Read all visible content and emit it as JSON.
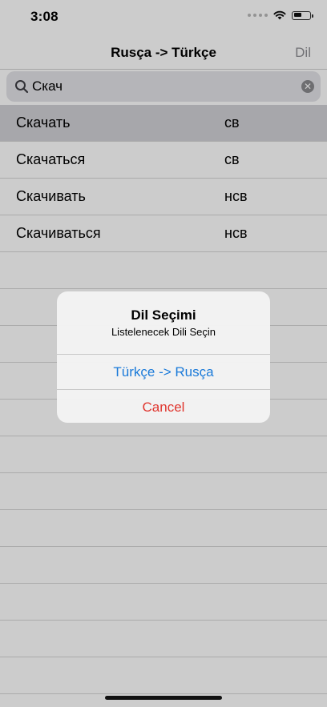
{
  "status_bar": {
    "time": "3:08",
    "battery_level": 0.55
  },
  "nav": {
    "title": "Rusça -> Türkçe",
    "action_label": "Dil"
  },
  "search": {
    "value": "Скач",
    "placeholder": ""
  },
  "rows": [
    {
      "word": "Скачать",
      "aspect": "св",
      "selected": true
    },
    {
      "word": "Скачаться",
      "aspect": "св",
      "selected": false
    },
    {
      "word": "Скачивать",
      "aspect": "нсв",
      "selected": false
    },
    {
      "word": "Скачиваться",
      "aspect": "нсв",
      "selected": false
    }
  ],
  "alert": {
    "title": "Dil Seçimi",
    "message": "Listelenecek Dili Seçin",
    "buttons": {
      "primary": "Türkçe -> Rusça",
      "cancel": "Cancel"
    }
  },
  "colors": {
    "primary_button": "#1a7ad9",
    "cancel_button": "#e0362f",
    "selected_row": "#d1d1d6"
  }
}
